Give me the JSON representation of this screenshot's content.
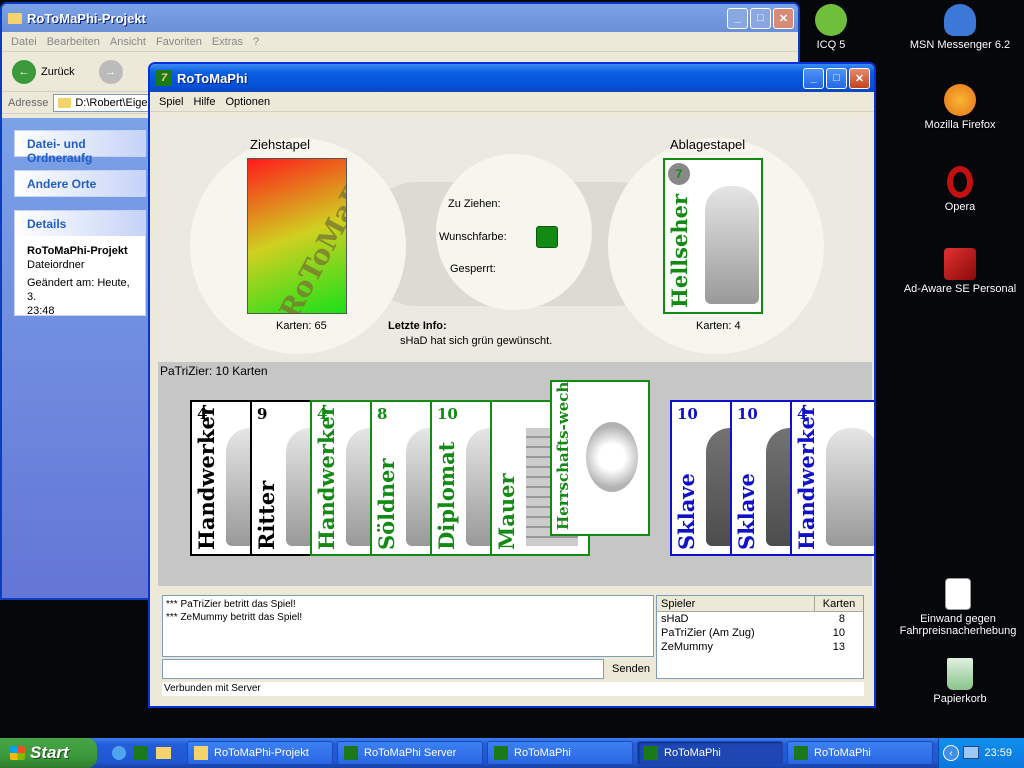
{
  "desktop": {
    "icons": [
      {
        "label": "ICQ 5",
        "color": "#6fbf3a"
      },
      {
        "label": "MSN Messenger 6.2",
        "color": "#3c78d8"
      },
      {
        "label": "Mozilla Firefox",
        "color": "#e8711c"
      },
      {
        "label": "Opera",
        "color": "#c41010"
      },
      {
        "label": "Ad-Aware SE Personal",
        "color": "#c02020"
      },
      {
        "label": "Einwand gegen Fahrpreisnacherhebung",
        "color": "#2b5cb8"
      },
      {
        "label": "Papierkorb",
        "color": "#6cbf4a"
      }
    ]
  },
  "explorer": {
    "title": "RoToMaPhi-Projekt",
    "menu": [
      "Datei",
      "Bearbeiten",
      "Ansicht",
      "Favoriten",
      "Extras",
      "?"
    ],
    "back_label": "Zurück",
    "address_label": "Adresse",
    "address_value": "D:\\Robert\\Eige",
    "panels": [
      "Datei- und Ordneraufg",
      "Andere Orte",
      "Details"
    ],
    "details": {
      "name": "RoToMaPhi-Projekt",
      "type": "Dateiordner",
      "changed": "Geändert am: Heute, 3.",
      "time": "23:48"
    }
  },
  "game": {
    "title": "RoToMaPhi",
    "menu": [
      "Spiel",
      "Hilfe",
      "Optionen"
    ],
    "draw_pile": {
      "label": "Ziehstapel",
      "count_label": "Karten:  65",
      "card_text": "RoToMaPhi"
    },
    "discard_pile": {
      "label": "Ablagestapel",
      "count_label": "Karten:  4",
      "card_name": "Hellseher",
      "card_number": "7"
    },
    "center": {
      "to_draw": "Zu Ziehen:",
      "wish_color": "Wunschfarbe:",
      "blocked": "Gesperrt:",
      "wish_color_value": "#138a13"
    },
    "last_info": {
      "label": "Letzte Info:",
      "text": "sHaD hat sich grün gewünscht."
    },
    "hand_label": "PaTriZier: 10 Karten",
    "hand": [
      {
        "name": "Handwerker",
        "num": "4",
        "color": "#000000"
      },
      {
        "name": "Ritter",
        "num": "9",
        "color": "#000000"
      },
      {
        "name": "Handwerker",
        "num": "4",
        "color": "#138a13"
      },
      {
        "name": "Söldner",
        "num": "8",
        "color": "#138a13"
      },
      {
        "name": "Diplomat",
        "num": "10",
        "color": "#138a13"
      },
      {
        "name": "Mauer",
        "num": "",
        "color": "#138a13"
      },
      {
        "name": "Herrschafts-wechsel",
        "num": "",
        "color": "#138a13"
      },
      {
        "name": "Sklave",
        "num": "10",
        "color": "#1010c8"
      },
      {
        "name": "Sklave",
        "num": "10",
        "color": "#1010c8"
      },
      {
        "name": "Handwerker",
        "num": "4",
        "color": "#1010c8"
      }
    ],
    "chat_lines": [
      "*** PaTriZier betritt das Spiel!",
      "*** ZeMummy betritt das Spiel!"
    ],
    "send_label": "Senden",
    "players_headers": [
      "Spieler",
      "Karten"
    ],
    "players": [
      {
        "name": "sHaD",
        "cards": "8"
      },
      {
        "name": "PaTriZier (Am Zug)",
        "cards": "10"
      },
      {
        "name": "ZeMummy",
        "cards": "13"
      }
    ],
    "status": "Verbunden mit Server"
  },
  "taskbar": {
    "start": "Start",
    "tasks": [
      "RoToMaPhi-Projekt",
      "RoToMaPhi Server",
      "RoToMaPhi",
      "RoToMaPhi",
      "RoToMaPhi"
    ],
    "clock": "23:59"
  }
}
